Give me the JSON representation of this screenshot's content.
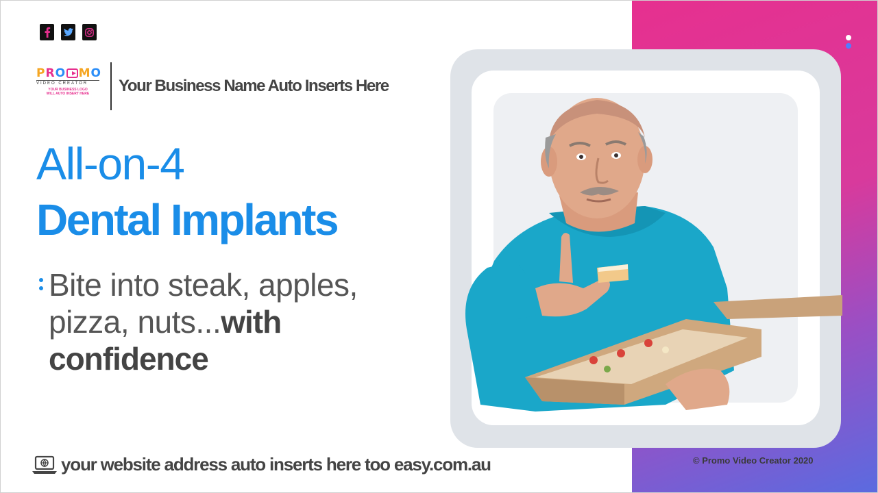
{
  "social": {
    "icons": [
      "facebook-icon",
      "twitter-icon",
      "instagram-icon"
    ]
  },
  "logo": {
    "word": "PROMO",
    "sub": "VIDEO CREATOR",
    "note_line1": "YOUR BUSINESS LOGO",
    "note_line2": "WILL AUTO INSERT HERE"
  },
  "header": {
    "business_name": "Your Business Name Auto Inserts Here"
  },
  "main": {
    "headline_1": "All-on-4",
    "headline_2": "Dental Implants",
    "body_regular": "Bite into steak, apples, pizza, nuts...",
    "body_bold": "with confidence"
  },
  "footer": {
    "website": "your website address auto inserts here too easy.com.au",
    "copyright": "©  Promo Video Creator 2020"
  },
  "colors": {
    "accent_blue": "#1a8de8",
    "gradient_pink": "#e6308f",
    "gradient_blue": "#5a6be0",
    "text_gray": "#444444"
  }
}
